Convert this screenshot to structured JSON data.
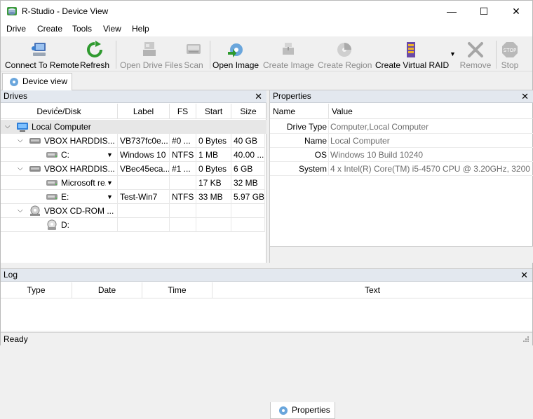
{
  "window": {
    "title": "R-Studio - Device View",
    "controls": {
      "minimize": "—",
      "maximize": "☐",
      "close": "✕"
    }
  },
  "menu": [
    "Drive",
    "Create",
    "Tools",
    "View",
    "Help"
  ],
  "toolbar": [
    {
      "label": "Connect To Remote",
      "icon": "computer-network-icon",
      "enabled": true
    },
    {
      "label": "Refresh",
      "icon": "refresh-icon",
      "enabled": true
    },
    {
      "label": "Open Drive Files",
      "icon": "drive-files-icon",
      "enabled": false
    },
    {
      "label": "Scan",
      "icon": "scan-icon",
      "enabled": false
    },
    {
      "label": "Open Image",
      "icon": "open-image-icon",
      "enabled": true
    },
    {
      "label": "Create Image",
      "icon": "create-image-icon",
      "enabled": false
    },
    {
      "label": "Create Region",
      "icon": "create-region-icon",
      "enabled": false
    },
    {
      "label": "Create Virtual RAID",
      "icon": "virtual-raid-icon",
      "enabled": true
    },
    {
      "label": "Remove",
      "icon": "remove-icon",
      "enabled": false
    },
    {
      "label": "Stop",
      "icon": "stop-icon",
      "enabled": false
    }
  ],
  "tabs": {
    "device_view": "Device view"
  },
  "drives": {
    "title": "Drives",
    "close": "✕",
    "columns": [
      "Device/Disk",
      "Label",
      "FS",
      "Start",
      "Size"
    ],
    "rows": [
      {
        "kind": "group",
        "level": 0,
        "name": "Local Computer",
        "label": "",
        "fs": "",
        "start": "",
        "size": ""
      },
      {
        "kind": "disk",
        "level": 1,
        "name": "VBOX HARDDIS...",
        "label": "VB737fc0e...",
        "fs": "#0 ...",
        "start": "0 Bytes",
        "size": "40 GB"
      },
      {
        "kind": "partition",
        "level": 2,
        "name": "C:",
        "label": "Windows 10",
        "fs": "NTFS",
        "start": "1 MB",
        "size": "40.00 ..."
      },
      {
        "kind": "disk",
        "level": 1,
        "name": "VBOX HARDDIS...",
        "label": "VBec45eca...",
        "fs": "#1 ...",
        "start": "0 Bytes",
        "size": "6 GB"
      },
      {
        "kind": "partition",
        "level": 2,
        "name": "Microsoft re...",
        "label": "",
        "fs": "",
        "start": "17 KB",
        "size": "32 MB"
      },
      {
        "kind": "partition",
        "level": 2,
        "name": "E:",
        "label": "Test-Win7",
        "fs": "NTFS",
        "start": "33 MB",
        "size": "5.97 GB"
      },
      {
        "kind": "cdrom",
        "level": 1,
        "name": "VBOX CD-ROM ...",
        "label": "",
        "fs": "",
        "start": "",
        "size": ""
      },
      {
        "kind": "cddrive",
        "level": 2,
        "name": "D:",
        "label": "",
        "fs": "",
        "start": "",
        "size": ""
      }
    ]
  },
  "properties": {
    "title": "Properties",
    "close": "✕",
    "columns": [
      "Name",
      "Value"
    ],
    "rows": [
      {
        "name": "Drive Type",
        "value": "Computer,Local Computer"
      },
      {
        "name": "Name",
        "value": "Local Computer"
      },
      {
        "name": "OS",
        "value": "Windows 10 Build 10240"
      },
      {
        "name": "System",
        "value": "4 x Intel(R) Core(TM) i5-4570 CPU @ 3.20GHz, 3200 ..."
      }
    ],
    "tab": "Properties"
  },
  "log": {
    "title": "Log",
    "close": "✕",
    "columns": [
      "Type",
      "Date",
      "Time",
      "Text"
    ]
  },
  "status": {
    "text": "Ready"
  }
}
